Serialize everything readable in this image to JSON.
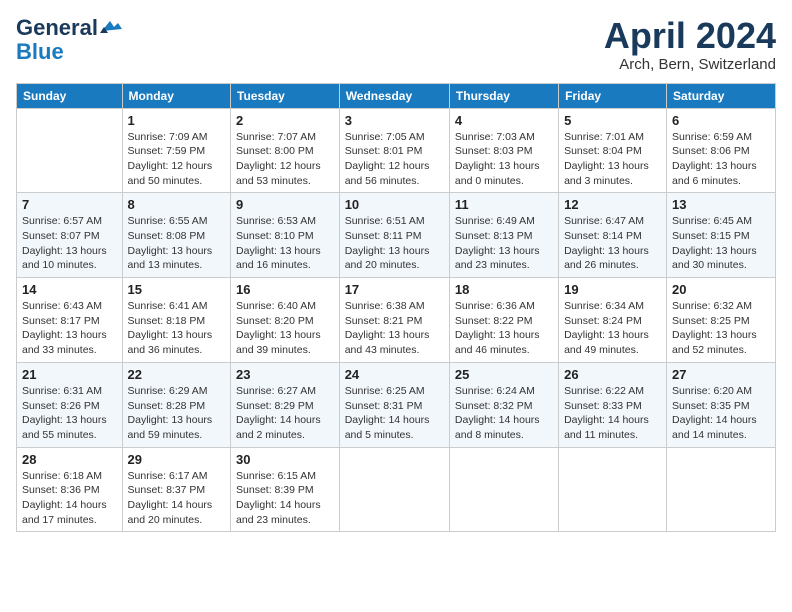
{
  "logo": {
    "line1": "General",
    "line2": "Blue"
  },
  "title": "April 2024",
  "subtitle": "Arch, Bern, Switzerland",
  "days_header": [
    "Sunday",
    "Monday",
    "Tuesday",
    "Wednesday",
    "Thursday",
    "Friday",
    "Saturday"
  ],
  "weeks": [
    [
      {
        "num": "",
        "info": ""
      },
      {
        "num": "1",
        "info": "Sunrise: 7:09 AM\nSunset: 7:59 PM\nDaylight: 12 hours\nand 50 minutes."
      },
      {
        "num": "2",
        "info": "Sunrise: 7:07 AM\nSunset: 8:00 PM\nDaylight: 12 hours\nand 53 minutes."
      },
      {
        "num": "3",
        "info": "Sunrise: 7:05 AM\nSunset: 8:01 PM\nDaylight: 12 hours\nand 56 minutes."
      },
      {
        "num": "4",
        "info": "Sunrise: 7:03 AM\nSunset: 8:03 PM\nDaylight: 13 hours\nand 0 minutes."
      },
      {
        "num": "5",
        "info": "Sunrise: 7:01 AM\nSunset: 8:04 PM\nDaylight: 13 hours\nand 3 minutes."
      },
      {
        "num": "6",
        "info": "Sunrise: 6:59 AM\nSunset: 8:06 PM\nDaylight: 13 hours\nand 6 minutes."
      }
    ],
    [
      {
        "num": "7",
        "info": "Sunrise: 6:57 AM\nSunset: 8:07 PM\nDaylight: 13 hours\nand 10 minutes."
      },
      {
        "num": "8",
        "info": "Sunrise: 6:55 AM\nSunset: 8:08 PM\nDaylight: 13 hours\nand 13 minutes."
      },
      {
        "num": "9",
        "info": "Sunrise: 6:53 AM\nSunset: 8:10 PM\nDaylight: 13 hours\nand 16 minutes."
      },
      {
        "num": "10",
        "info": "Sunrise: 6:51 AM\nSunset: 8:11 PM\nDaylight: 13 hours\nand 20 minutes."
      },
      {
        "num": "11",
        "info": "Sunrise: 6:49 AM\nSunset: 8:13 PM\nDaylight: 13 hours\nand 23 minutes."
      },
      {
        "num": "12",
        "info": "Sunrise: 6:47 AM\nSunset: 8:14 PM\nDaylight: 13 hours\nand 26 minutes."
      },
      {
        "num": "13",
        "info": "Sunrise: 6:45 AM\nSunset: 8:15 PM\nDaylight: 13 hours\nand 30 minutes."
      }
    ],
    [
      {
        "num": "14",
        "info": "Sunrise: 6:43 AM\nSunset: 8:17 PM\nDaylight: 13 hours\nand 33 minutes."
      },
      {
        "num": "15",
        "info": "Sunrise: 6:41 AM\nSunset: 8:18 PM\nDaylight: 13 hours\nand 36 minutes."
      },
      {
        "num": "16",
        "info": "Sunrise: 6:40 AM\nSunset: 8:20 PM\nDaylight: 13 hours\nand 39 minutes."
      },
      {
        "num": "17",
        "info": "Sunrise: 6:38 AM\nSunset: 8:21 PM\nDaylight: 13 hours\nand 43 minutes."
      },
      {
        "num": "18",
        "info": "Sunrise: 6:36 AM\nSunset: 8:22 PM\nDaylight: 13 hours\nand 46 minutes."
      },
      {
        "num": "19",
        "info": "Sunrise: 6:34 AM\nSunset: 8:24 PM\nDaylight: 13 hours\nand 49 minutes."
      },
      {
        "num": "20",
        "info": "Sunrise: 6:32 AM\nSunset: 8:25 PM\nDaylight: 13 hours\nand 52 minutes."
      }
    ],
    [
      {
        "num": "21",
        "info": "Sunrise: 6:31 AM\nSunset: 8:26 PM\nDaylight: 13 hours\nand 55 minutes."
      },
      {
        "num": "22",
        "info": "Sunrise: 6:29 AM\nSunset: 8:28 PM\nDaylight: 13 hours\nand 59 minutes."
      },
      {
        "num": "23",
        "info": "Sunrise: 6:27 AM\nSunset: 8:29 PM\nDaylight: 14 hours\nand 2 minutes."
      },
      {
        "num": "24",
        "info": "Sunrise: 6:25 AM\nSunset: 8:31 PM\nDaylight: 14 hours\nand 5 minutes."
      },
      {
        "num": "25",
        "info": "Sunrise: 6:24 AM\nSunset: 8:32 PM\nDaylight: 14 hours\nand 8 minutes."
      },
      {
        "num": "26",
        "info": "Sunrise: 6:22 AM\nSunset: 8:33 PM\nDaylight: 14 hours\nand 11 minutes."
      },
      {
        "num": "27",
        "info": "Sunrise: 6:20 AM\nSunset: 8:35 PM\nDaylight: 14 hours\nand 14 minutes."
      }
    ],
    [
      {
        "num": "28",
        "info": "Sunrise: 6:18 AM\nSunset: 8:36 PM\nDaylight: 14 hours\nand 17 minutes."
      },
      {
        "num": "29",
        "info": "Sunrise: 6:17 AM\nSunset: 8:37 PM\nDaylight: 14 hours\nand 20 minutes."
      },
      {
        "num": "30",
        "info": "Sunrise: 6:15 AM\nSunset: 8:39 PM\nDaylight: 14 hours\nand 23 minutes."
      },
      {
        "num": "",
        "info": ""
      },
      {
        "num": "",
        "info": ""
      },
      {
        "num": "",
        "info": ""
      },
      {
        "num": "",
        "info": ""
      }
    ]
  ]
}
